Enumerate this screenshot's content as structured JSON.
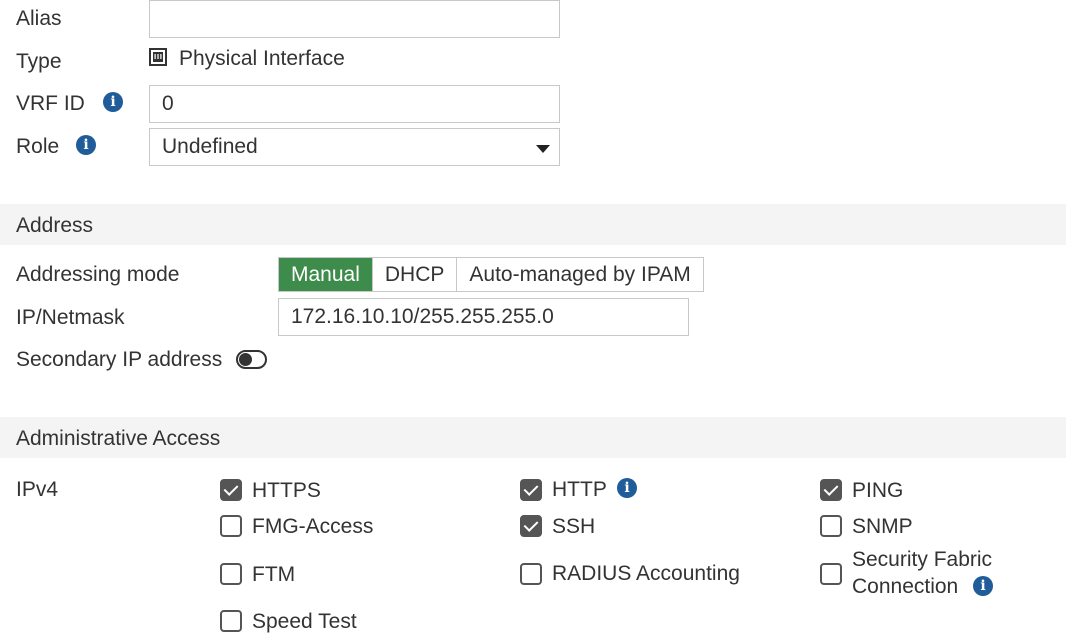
{
  "fields": {
    "alias_label": "Alias",
    "alias_value": "",
    "type_label": "Type",
    "type_value": "Physical Interface",
    "vrf_label": "VRF ID",
    "vrf_value": "0",
    "role_label": "Role",
    "role_value": "Undefined"
  },
  "address": {
    "section_title": "Address",
    "addressing_mode_label": "Addressing mode",
    "modes": [
      "Manual",
      "DHCP",
      "Auto-managed by IPAM"
    ],
    "selected_mode": "Manual",
    "ip_label": "IP/Netmask",
    "ip_value": "172.16.10.10/255.255.255.0",
    "secondary_label": "Secondary IP address",
    "secondary_enabled": false
  },
  "admin": {
    "section_title": "Administrative Access",
    "ipv4_label": "IPv4",
    "options": [
      {
        "label": "HTTPS",
        "checked": true
      },
      {
        "label": "HTTP",
        "checked": true
      },
      {
        "label": "PING",
        "checked": true
      },
      {
        "label": "FMG-Access",
        "checked": false
      },
      {
        "label": "SSH",
        "checked": true
      },
      {
        "label": "SNMP",
        "checked": false
      },
      {
        "label": "FTM",
        "checked": false
      },
      {
        "label": "RADIUS Accounting",
        "checked": false
      },
      {
        "label": "Security Fabric",
        "label2": "Connection",
        "checked": false
      },
      {
        "label": "Speed Test",
        "checked": false
      }
    ]
  },
  "colors": {
    "active_mode": "#3e8c4c",
    "info_icon": "#1f5c99"
  }
}
